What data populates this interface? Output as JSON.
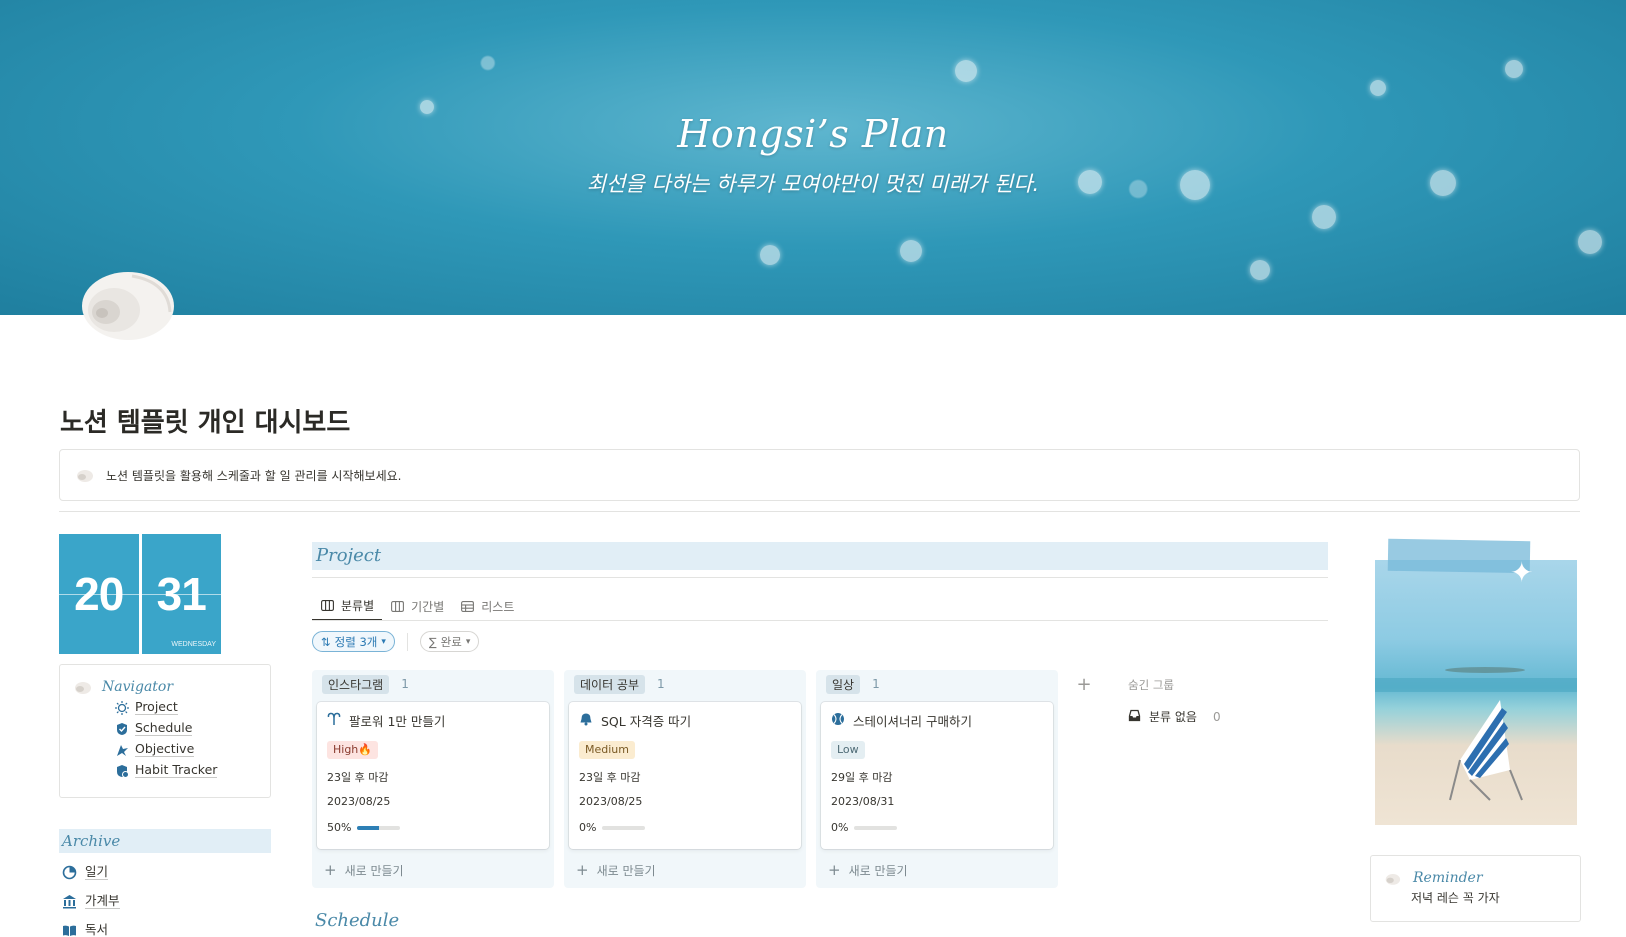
{
  "cover": {
    "title": "Hongsi’s Plan",
    "subtitle": "최선을 다하는 하루가 모여야만이 멋진 미래가 된다."
  },
  "page": {
    "title": "노션 템플릿 개인 대시보드",
    "callout": "노션 템플릿을 활용해 스케줄과 할 일 관리를 시작해보세요."
  },
  "clock": {
    "hour": "20",
    "minute": "31",
    "day": "WEDNESDAY",
    "color": "#3aa5c9"
  },
  "navigator": {
    "title": "Navigator",
    "items": [
      {
        "label": "Project",
        "icon": "sun-gear-icon"
      },
      {
        "label": "Schedule",
        "icon": "calendar-check-icon"
      },
      {
        "label": "Objective",
        "icon": "flag-icon"
      },
      {
        "label": "Habit Tracker",
        "icon": "habit-check-icon"
      }
    ]
  },
  "archive": {
    "title": "Archive",
    "items": [
      {
        "label": "일기",
        "icon": "clock-icon"
      },
      {
        "label": "가계부",
        "icon": "bank-icon"
      },
      {
        "label": "독서",
        "icon": "book-icon"
      }
    ]
  },
  "project": {
    "title": "Project",
    "tabs": [
      {
        "label": "분류별",
        "icon": "board-icon"
      },
      {
        "label": "기간별",
        "icon": "board-icon"
      },
      {
        "label": "리스트",
        "icon": "table-icon"
      }
    ],
    "sort_label": "정렬 3개",
    "filter_label": "완료",
    "columns": [
      {
        "name": "인스타그램",
        "count": "1",
        "card": {
          "title": "팔로워 1만 만들기",
          "priority": "High🔥",
          "priority_level": "high",
          "deadline": "23일 후 마감",
          "date": "2023/08/25",
          "progress_text": "50%",
          "progress": 0.5,
          "icon": "aries-icon"
        }
      },
      {
        "name": "데이터 공부",
        "count": "1",
        "card": {
          "title": "SQL 자격증 따기",
          "priority": "Medium",
          "priority_level": "medium",
          "deadline": "23일 후 마감",
          "date": "2023/08/25",
          "progress_text": "0%",
          "progress": 0,
          "icon": "bell-icon"
        }
      },
      {
        "name": "일상",
        "count": "1",
        "card": {
          "title": "스테이셔너리 구매하기",
          "priority": "Low",
          "priority_level": "low",
          "deadline": "29일 후 마감",
          "date": "2023/08/31",
          "progress_text": "0%",
          "progress": 0,
          "icon": "ball-icon"
        }
      }
    ],
    "new_label": "새로 만들기",
    "hidden_groups_label": "숨긴 그룹",
    "no_category": {
      "label": "분류 없음",
      "count": "0"
    }
  },
  "schedule": {
    "title": "Schedule"
  },
  "reminder": {
    "title": "Reminder",
    "text": "저녁 레슨 꼭 가자"
  },
  "colors": {
    "accent": "#3aa5c9",
    "section_bg": "#e1eef6",
    "progress": "#2d7fb5"
  }
}
